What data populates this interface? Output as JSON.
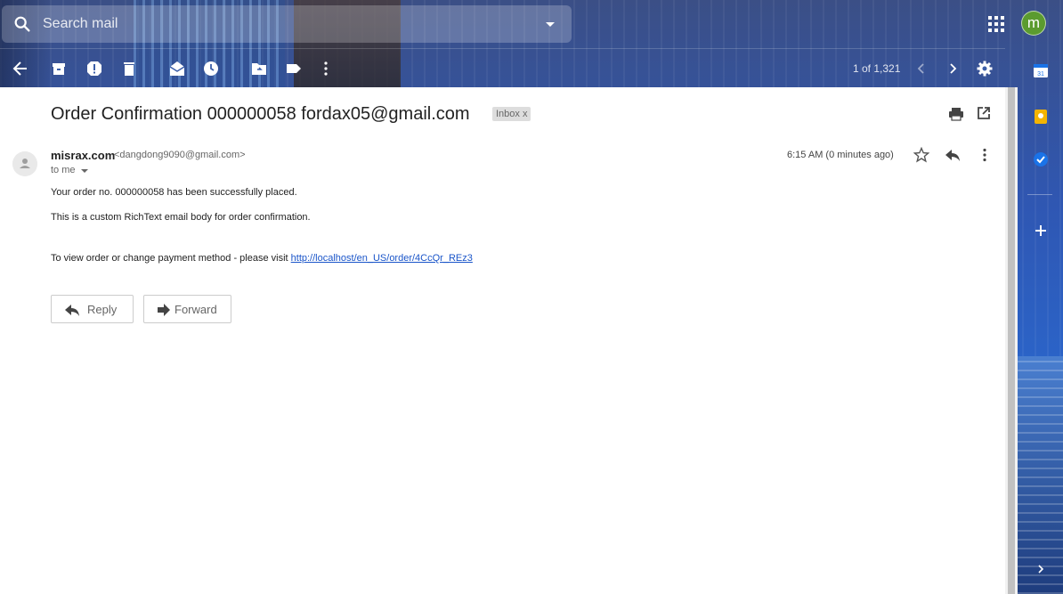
{
  "search": {
    "placeholder": "Search mail"
  },
  "account": {
    "avatar_letter": "m",
    "avatar_color": "#5b9b2f"
  },
  "toolbar": {
    "pager": "1 of 1,321"
  },
  "email": {
    "subject": "Order Confirmation 000000058 fordax05@gmail.com",
    "label_chip": "Inbox x",
    "sender_name": "misrax.com",
    "sender_email": "<dangdong9090@gmail.com>",
    "to": "to me",
    "time": "6:15 AM (0 minutes ago)",
    "body": {
      "line1": "Your order no. 000000058 has been successfully placed.",
      "line2": "This is a custom RichText email body for order confirmation.",
      "line3_prefix": "To view order or change payment method - please visit",
      "line3_link": "http://localhost/en_US/order/4CcQr_REz3"
    },
    "reply_label": "Reply",
    "forward_label": "Forward"
  },
  "colors": {
    "link": "#1a55c9",
    "accent_blue": "#1a73e8",
    "keep_yellow": "#f4b400"
  }
}
